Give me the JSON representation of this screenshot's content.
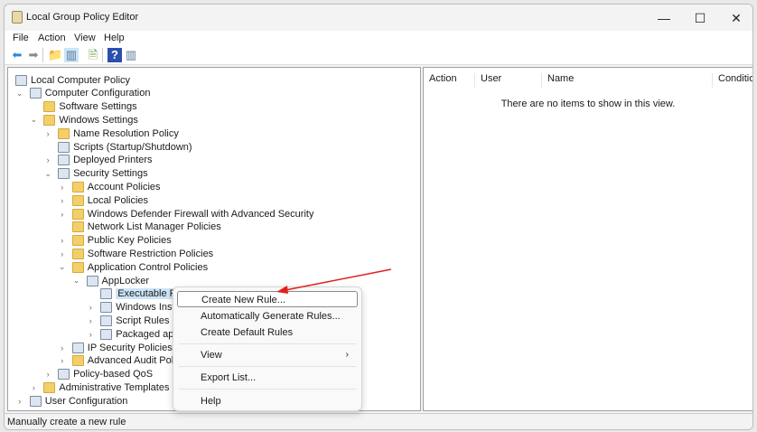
{
  "window": {
    "title": "Local Group Policy Editor",
    "minimize": "—",
    "maximize": "☐",
    "close": "✕"
  },
  "menu": [
    "File",
    "Action",
    "View",
    "Help"
  ],
  "toolbar": [
    {
      "icon": "back-arrow-icon",
      "glyph": "⬅",
      "color": "#2d8ad8"
    },
    {
      "icon": "forward-arrow-icon",
      "glyph": "➡",
      "color": "#8a8a8a"
    },
    {
      "icon": "up-folder-icon",
      "glyph": "📁",
      "color": "#c99a2a"
    },
    {
      "icon": "show-hide-tree-icon",
      "glyph": "▥",
      "color": "#5a7a9a"
    },
    {
      "icon": "export-list-icon",
      "glyph": "🗎",
      "color": "#6a9a3a"
    },
    {
      "icon": "help-icon",
      "glyph": "?",
      "color": "#fff"
    },
    {
      "icon": "show-hide-action-pane-icon",
      "glyph": "▥",
      "color": "#5a7a9a"
    }
  ],
  "tree": [
    {
      "label": "Local Computer Policy",
      "level": 0,
      "state": "none",
      "icon": "policy"
    },
    {
      "label": "Computer Configuration",
      "level": 1,
      "state": "expanded",
      "icon": "computer"
    },
    {
      "label": "Software Settings",
      "level": 2,
      "state": "none",
      "icon": "folder"
    },
    {
      "label": "Windows Settings",
      "level": 2,
      "state": "expanded",
      "icon": "folder"
    },
    {
      "label": "Name Resolution Policy",
      "level": 3,
      "state": "collapsed",
      "icon": "folder"
    },
    {
      "label": "Scripts (Startup/Shutdown)",
      "level": 3,
      "state": "none",
      "icon": "script"
    },
    {
      "label": "Deployed Printers",
      "level": 3,
      "state": "collapsed",
      "icon": "printer"
    },
    {
      "label": "Security Settings",
      "level": 3,
      "state": "expanded",
      "icon": "security"
    },
    {
      "label": "Account Policies",
      "level": 4,
      "state": "collapsed",
      "icon": "lockfolder"
    },
    {
      "label": "Local Policies",
      "level": 4,
      "state": "collapsed",
      "icon": "lockfolder"
    },
    {
      "label": "Windows Defender Firewall with Advanced Security",
      "level": 4,
      "state": "collapsed",
      "icon": "folder"
    },
    {
      "label": "Network List Manager Policies",
      "level": 4,
      "state": "none",
      "icon": "folder"
    },
    {
      "label": "Public Key Policies",
      "level": 4,
      "state": "collapsed",
      "icon": "folder"
    },
    {
      "label": "Software Restriction Policies",
      "level": 4,
      "state": "collapsed",
      "icon": "folder"
    },
    {
      "label": "Application Control Policies",
      "level": 4,
      "state": "expanded",
      "icon": "folder"
    },
    {
      "label": "AppLocker",
      "level": 5,
      "state": "expanded",
      "icon": "applocker"
    },
    {
      "label": "Executable Rules",
      "level": 6,
      "state": "none",
      "icon": "rules",
      "selected": true
    },
    {
      "label": "Windows Installer Rules",
      "level": 6,
      "state": "collapsed",
      "icon": "installer"
    },
    {
      "label": "Script Rules",
      "level": 6,
      "state": "collapsed",
      "icon": "script"
    },
    {
      "label": "Packaged app Rules",
      "level": 6,
      "state": "collapsed",
      "icon": "packaged"
    },
    {
      "label": "IP Security Policies on Local Computer",
      "level": 4,
      "state": "collapsed",
      "icon": "ipsec"
    },
    {
      "label": "Advanced Audit Policy Configuration",
      "level": 4,
      "state": "collapsed",
      "icon": "folder"
    },
    {
      "label": "Policy-based QoS",
      "level": 3,
      "state": "collapsed",
      "icon": "qos"
    },
    {
      "label": "Administrative Templates",
      "level": 2,
      "state": "collapsed",
      "icon": "folder"
    },
    {
      "label": "User Configuration",
      "level": 1,
      "state": "collapsed",
      "icon": "user"
    }
  ],
  "details": {
    "columns": [
      "Action",
      "User",
      "Name",
      "Conditio"
    ],
    "empty_message": "There are no items to show in this view."
  },
  "context_menu": [
    {
      "label": "Create New Rule...",
      "highlighted": true
    },
    {
      "label": "Automatically Generate Rules..."
    },
    {
      "label": "Create Default Rules"
    },
    {
      "separator": true
    },
    {
      "label": "View",
      "submenu": true
    },
    {
      "separator": true
    },
    {
      "label": "Export List..."
    },
    {
      "separator": true
    },
    {
      "label": "Help"
    }
  ],
  "status": "Manually create a new rule",
  "colors": {
    "annotation_arrow": "#e02020",
    "selection": "#cce4f7"
  }
}
